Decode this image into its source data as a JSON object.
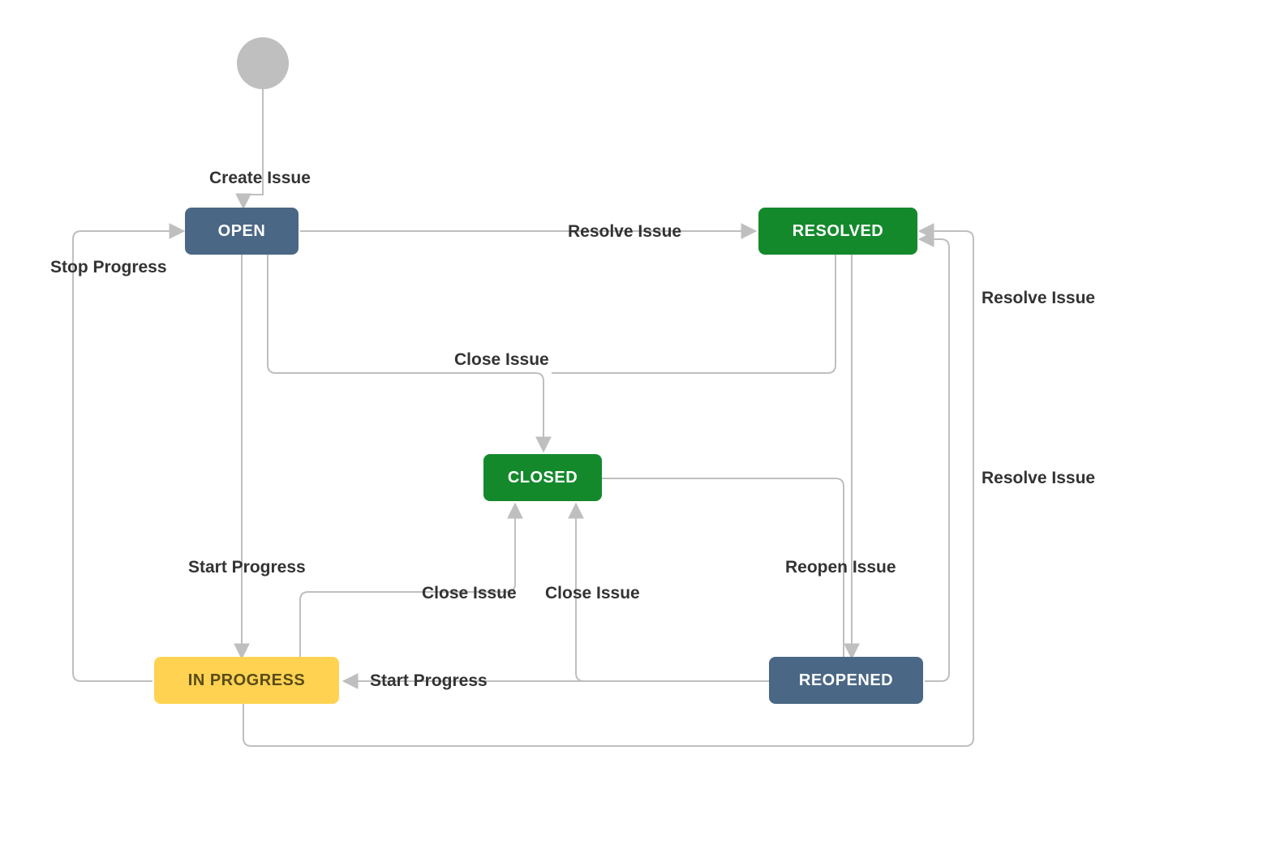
{
  "states": {
    "open": {
      "label": "OPEN",
      "color": "blue"
    },
    "resolved": {
      "label": "RESOLVED",
      "color": "green"
    },
    "closed": {
      "label": "CLOSED",
      "color": "green"
    },
    "reopened": {
      "label": "REOPENED",
      "color": "blue"
    },
    "in_progress": {
      "label": "IN PROGRESS",
      "color": "yellow"
    }
  },
  "transitions": {
    "create_issue": "Create Issue",
    "stop_progress": "Stop Progress",
    "resolve_issue": "Resolve Issue",
    "resolve_issue2": "Resolve Issue",
    "resolve_issue3": "Resolve Issue",
    "close_issue": "Close Issue",
    "close_issue2": "Close Issue",
    "close_issue3": "Close Issue",
    "start_progress": "Start Progress",
    "start_progress2": "Start Progress",
    "reopen_issue": "Reopen Issue"
  },
  "colors": {
    "edge": "#bfbfbf",
    "text": "#333333"
  }
}
